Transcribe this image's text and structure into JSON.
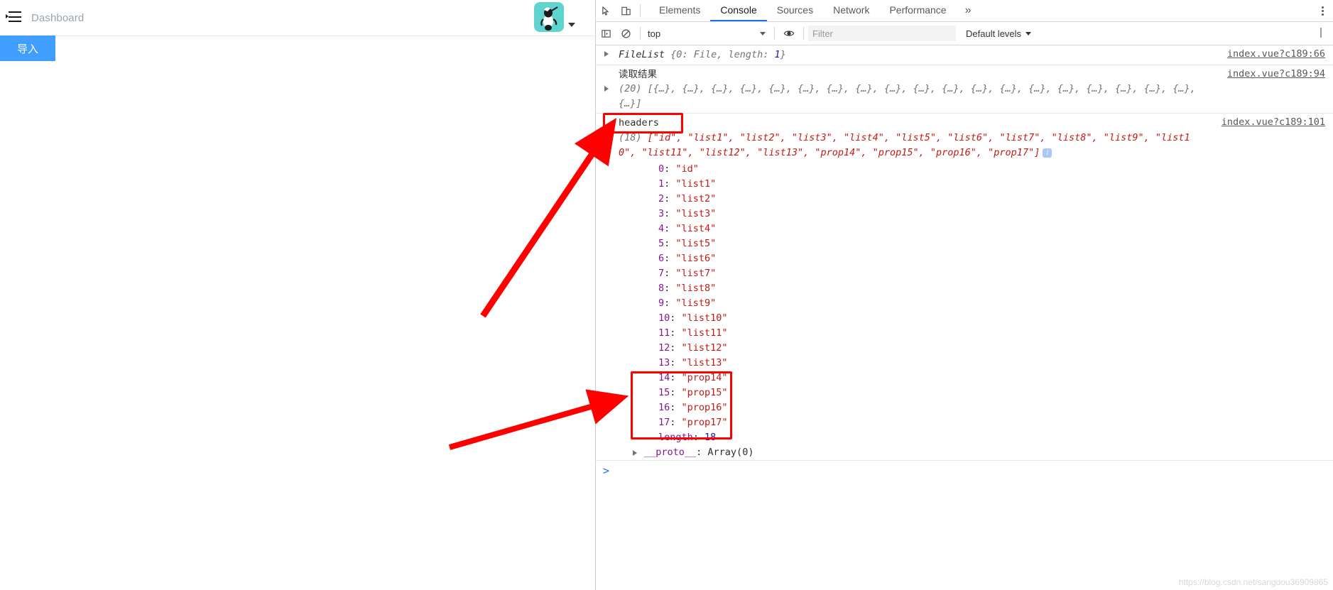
{
  "webpage": {
    "menu_icon": "hamburger-menu-icon",
    "breadcrumb": "Dashboard",
    "avatar_icon": "user-avatar-icon",
    "caret_icon": "chevron-down-icon",
    "import_button": "导入"
  },
  "devtools": {
    "inspect_icon": "inspect-element-icon",
    "device_icon": "device-toolbar-icon",
    "tabs": [
      {
        "label": "Elements",
        "active": false
      },
      {
        "label": "Console",
        "active": true
      },
      {
        "label": "Sources",
        "active": false
      },
      {
        "label": "Network",
        "active": false
      },
      {
        "label": "Performance",
        "active": false
      }
    ],
    "more_tabs_icon": "chevron-double-right-icon",
    "menu_icon": "kebab-menu-icon",
    "filterbar": {
      "sidebar_icon": "show-console-sidebar-icon",
      "clear_icon": "clear-console-icon",
      "context": "top",
      "eye_icon": "live-expression-icon",
      "filter_placeholder": "Filter",
      "filter_value": "",
      "levels": "Default levels"
    },
    "accent": "#1a73e8"
  },
  "console": {
    "messages": [
      {
        "id": "filelist",
        "expandable": true,
        "source": "index.vue?c189:66",
        "parts": [
          {
            "t": "FileList ",
            "c": "obj-name"
          },
          {
            "t": "{",
            "c": "grey"
          },
          {
            "t": "0",
            "c": "grey"
          },
          {
            "t": ": ",
            "c": "grey"
          },
          {
            "t": "File",
            "c": "grey"
          },
          {
            "t": ", ",
            "c": "grey"
          },
          {
            "t": "length",
            "c": "grey"
          },
          {
            "t": ": ",
            "c": "grey"
          },
          {
            "t": "1",
            "c": "num"
          },
          {
            "t": "}",
            "c": "grey"
          }
        ]
      },
      {
        "id": "read-result",
        "expandable": true,
        "label": "读取结果",
        "source": "index.vue?c189:94",
        "array_count": "(20)",
        "array_preview": "[{…}, {…}, {…}, {…}, {…}, {…}, {…}, {…}, {…}, {…}, {…}, {…}, {…}, {…}, {…}, {…}, {…}, {…}, {…}, {…}]"
      },
      {
        "id": "headers",
        "expandable": true,
        "expanded": true,
        "label": "headers",
        "source": "index.vue?c189:101",
        "array_count": "(18)",
        "array_preview": "[\"id\", \"list1\", \"list2\", \"list3\", \"list4\", \"list5\", \"list6\", \"list7\", \"list8\", \"list9\", \"list10\", \"list11\", \"list12\", \"list13\", \"prop14\", \"prop15\", \"prop16\", \"prop17\"]",
        "info_badge": "i"
      }
    ],
    "array_items": [
      {
        "index": "0",
        "value": "\"id\""
      },
      {
        "index": "1",
        "value": "\"list1\""
      },
      {
        "index": "2",
        "value": "\"list2\""
      },
      {
        "index": "3",
        "value": "\"list3\""
      },
      {
        "index": "4",
        "value": "\"list4\""
      },
      {
        "index": "5",
        "value": "\"list5\""
      },
      {
        "index": "6",
        "value": "\"list6\""
      },
      {
        "index": "7",
        "value": "\"list7\""
      },
      {
        "index": "8",
        "value": "\"list8\""
      },
      {
        "index": "9",
        "value": "\"list9\""
      },
      {
        "index": "10",
        "value": "\"list10\""
      },
      {
        "index": "11",
        "value": "\"list11\""
      },
      {
        "index": "12",
        "value": "\"list12\""
      },
      {
        "index": "13",
        "value": "\"list13\""
      },
      {
        "index": "14",
        "value": "\"prop14\""
      },
      {
        "index": "15",
        "value": "\"prop15\""
      },
      {
        "index": "16",
        "value": "\"prop16\""
      },
      {
        "index": "17",
        "value": "\"prop17\""
      }
    ],
    "length_label": "length",
    "length_value": "18",
    "proto_label": "__proto__",
    "proto_value": "Array(0)",
    "prompt": ">"
  },
  "annotations": {
    "color": "#fe0000",
    "box_headers": "highlight-headers-label",
    "box_props": "highlight-prop14-17-items",
    "arrow_upper": "arrow-pointing-to-headers",
    "arrow_lower": "arrow-pointing-to-prop-items"
  },
  "watermark": "https://blog.csdn.net/sangdou36909865"
}
